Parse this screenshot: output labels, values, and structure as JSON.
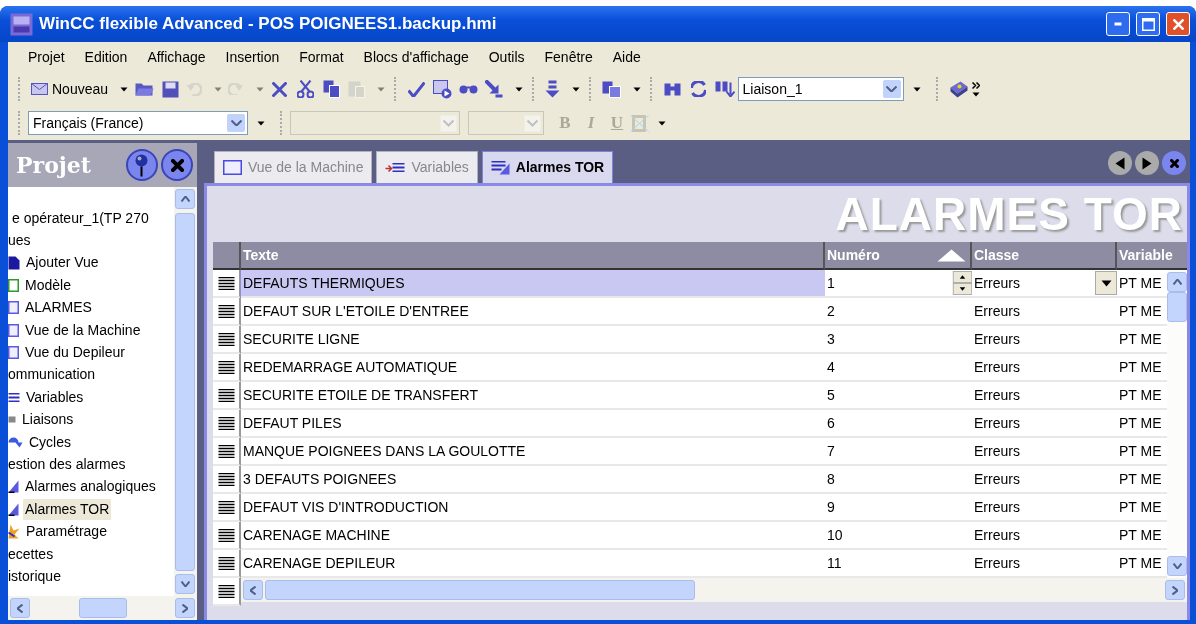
{
  "window": {
    "title": "WinCC flexible Advanced - POS POIGNEES1.backup.hmi"
  },
  "menu": [
    {
      "label": "Projet"
    },
    {
      "label": "Edition"
    },
    {
      "label": "Affichage"
    },
    {
      "label": "Insertion"
    },
    {
      "label": "Format"
    },
    {
      "label": "Blocs d'affichage"
    },
    {
      "label": "Outils"
    },
    {
      "label": "Fenêtre"
    },
    {
      "label": "Aide"
    }
  ],
  "toolbar": [
    [
      {
        "kind": "new",
        "label": "Nouveau",
        "dropdown": true,
        "disabled": false
      },
      {
        "kind": "open",
        "dropdown": false,
        "disabled": false
      },
      {
        "kind": "save",
        "dropdown": false,
        "disabled": false
      },
      {
        "kind": "undo",
        "dropdown": true,
        "disabled": true
      },
      {
        "kind": "redo",
        "dropdown": true,
        "disabled": true
      },
      {
        "kind": "delete",
        "dropdown": false,
        "disabled": false
      },
      {
        "kind": "cut",
        "dropdown": false,
        "disabled": false
      },
      {
        "kind": "copy",
        "dropdown": false,
        "disabled": false
      },
      {
        "kind": "paste",
        "dropdown": true,
        "disabled": true
      }
    ],
    [
      {
        "kind": "check",
        "dropdown": false,
        "disabled": false
      },
      {
        "kind": "runtime",
        "dropdown": false,
        "disabled": false
      },
      {
        "kind": "glasses",
        "dropdown": false,
        "disabled": false
      },
      {
        "kind": "transfer",
        "dropdown": true,
        "disabled": false
      }
    ],
    [
      {
        "kind": "download",
        "dropdown": true,
        "disabled": false
      }
    ],
    [
      {
        "kind": "windows",
        "dropdown": true,
        "disabled": false
      }
    ],
    [
      {
        "kind": "binoculars",
        "dropdown": false,
        "disabled": false
      },
      {
        "kind": "swap",
        "dropdown": false,
        "disabled": false
      },
      {
        "kind": "finddown",
        "dropdown": false,
        "disabled": false
      },
      {
        "kind": "combo",
        "value": "Liaison_1",
        "disabled": false
      }
    ],
    [
      {
        "kind": "book",
        "dropdown": false,
        "disabled": false
      }
    ]
  ],
  "format_bar": {
    "language": "Français (France)",
    "combos_disabled": true,
    "styles": [
      {
        "label": "B",
        "kind": "bold",
        "disabled": true
      },
      {
        "label": "I",
        "kind": "italic",
        "disabled": true
      },
      {
        "label": "U",
        "kind": "underline",
        "disabled": true
      }
    ]
  },
  "sidebar": {
    "title": "Projet",
    "tree": [
      {
        "label": "e opérateur_1(TP 270",
        "children": [
          {
            "label": "ues",
            "children": [
              {
                "label": "Ajouter Vue",
                "kind": "add",
                "selected": false
              },
              {
                "label": "Modèle",
                "kind": "template",
                "selected": false
              },
              {
                "label": "ALARMES",
                "kind": "screen",
                "selected": false
              },
              {
                "label": "Vue de la Machine",
                "kind": "screen",
                "selected": false
              },
              {
                "label": "Vue du Depileur",
                "kind": "screen",
                "selected": false
              }
            ]
          },
          {
            "label": "ommunication",
            "children": [
              {
                "label": "Variables",
                "kind": "tags",
                "selected": false
              },
              {
                "label": "Liaisons",
                "kind": "connection",
                "selected": false
              },
              {
                "label": "Cycles",
                "kind": "cycle",
                "selected": false
              }
            ]
          },
          {
            "label": "estion des alarmes",
            "children": [
              {
                "label": "Alarmes analogiques",
                "kind": "alarm",
                "selected": false
              },
              {
                "label": "Alarmes TOR",
                "kind": "alarm",
                "selected": true
              },
              {
                "label": "Paramétrage",
                "kind": "settings",
                "selected": false
              }
            ]
          },
          {
            "label": "ecettes"
          },
          {
            "label": "istorique"
          }
        ]
      }
    ]
  },
  "tabs": [
    {
      "label": "Vue de la Machine",
      "kind": "screen",
      "selected": false
    },
    {
      "label": "Variables",
      "kind": "tags",
      "selected": false
    },
    {
      "label": "Alarmes TOR",
      "kind": "alarm",
      "selected": true
    }
  ],
  "editor_title": "ALARMES TOR",
  "table": {
    "columns": [
      {
        "label": "Texte",
        "sorted": false
      },
      {
        "label": "Numéro",
        "sorted": true
      },
      {
        "label": "Classe",
        "sorted": false
      },
      {
        "label": "Variable",
        "sorted": false
      }
    ],
    "rows": [
      {
        "text": "DEFAUTS THERMIQUES",
        "number": "1",
        "class": "Erreurs",
        "variable": "PT ME",
        "selected": true
      },
      {
        "text": "DEFAUT SUR L'ETOILE D'ENTREE",
        "number": "2",
        "class": "Erreurs",
        "variable": "PT ME",
        "selected": false
      },
      {
        "text": "SECURITE LIGNE",
        "number": "3",
        "class": "Erreurs",
        "variable": "PT ME",
        "selected": false
      },
      {
        "text": "REDEMARRAGE AUTOMATIQUE",
        "number": "4",
        "class": "Erreurs",
        "variable": "PT ME",
        "selected": false
      },
      {
        "text": "SECURITE ETOILE DE TRANSFERT",
        "number": "5",
        "class": "Erreurs",
        "variable": "PT ME",
        "selected": false
      },
      {
        "text": "DEFAUT PILES",
        "number": "6",
        "class": "Erreurs",
        "variable": "PT ME",
        "selected": false
      },
      {
        "text": "MANQUE POIGNEES DANS LA GOULOTTE",
        "number": "7",
        "class": "Erreurs",
        "variable": "PT ME",
        "selected": false
      },
      {
        "text": "3 DEFAUTS POIGNEES",
        "number": "8",
        "class": "Erreurs",
        "variable": "PT ME",
        "selected": false
      },
      {
        "text": "DEFAUT VIS D'INTRODUCTION",
        "number": "9",
        "class": "Erreurs",
        "variable": "PT ME",
        "selected": false
      },
      {
        "text": "CARENAGE MACHINE",
        "number": "10",
        "class": "Erreurs",
        "variable": "PT ME",
        "selected": false
      },
      {
        "text": "CARENAGE DEPILEUR",
        "number": "11",
        "class": "Erreurs",
        "variable": "PT ME",
        "selected": false
      }
    ]
  }
}
